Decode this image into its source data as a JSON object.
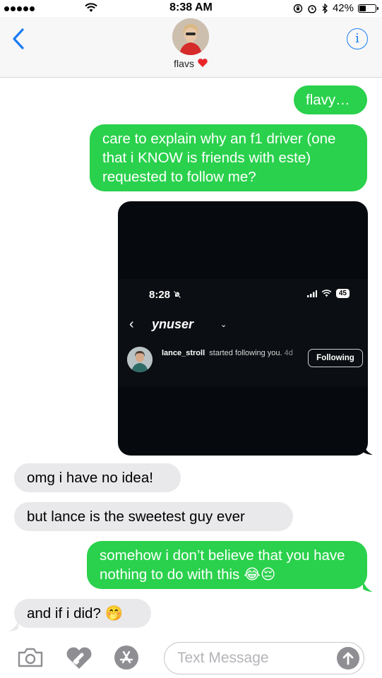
{
  "status_bar": {
    "time": "8:38 AM",
    "battery_percent": "42%",
    "battery_level": 0.42
  },
  "header": {
    "contact_name": "flavs",
    "info_label": "i"
  },
  "messages": [
    {
      "side": "sent",
      "text": "flavy…"
    },
    {
      "side": "sent",
      "text": "care to explain why an f1 driver (one that i KNOW is friends with este) requested to follow me?"
    },
    {
      "side": "sent",
      "type": "image"
    },
    {
      "side": "received",
      "text": "omg i have no idea!"
    },
    {
      "side": "received",
      "text": "but lance is the sweetest guy ever"
    },
    {
      "side": "sent",
      "text": "somehow i don’t believe that you have nothing to do with this 😂😔"
    },
    {
      "side": "received",
      "text": "and if i did? 🤭"
    }
  ],
  "screenshot": {
    "time": "8:28",
    "battery": "45",
    "username": "ynuser",
    "follower": "lance_stroll",
    "activity": "started following you.",
    "age": "4d",
    "button_label": "Following"
  },
  "input": {
    "placeholder": "Text Message"
  },
  "colors": {
    "sent": "#2ad14c",
    "received": "#e9e9eb",
    "accent": "#1a7cf2"
  },
  "icons": [
    "back-chevron-icon",
    "info-icon",
    "camera-icon",
    "digital-touch-icon",
    "app-store-icon",
    "send-arrow-icon"
  ]
}
